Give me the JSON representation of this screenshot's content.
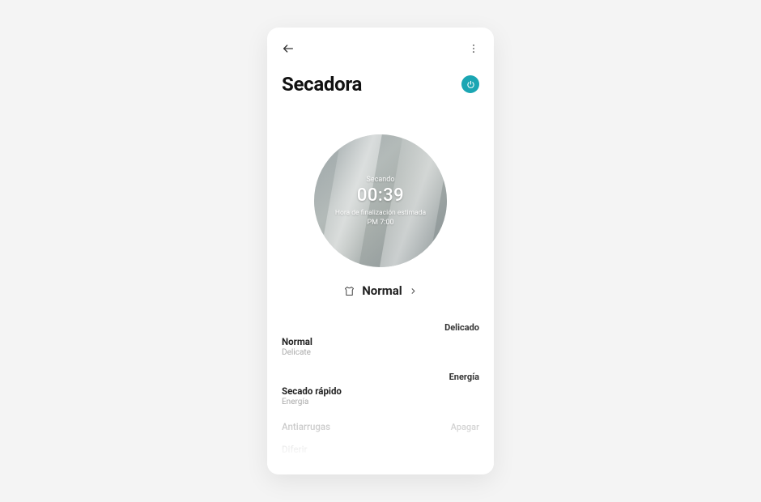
{
  "header": {
    "title": "Secadora"
  },
  "dial": {
    "status": "Secando",
    "time": "00:39",
    "subtitle": "Hora de finalización estimada",
    "eta": "PM 7:00"
  },
  "mode": {
    "label": "Normal"
  },
  "options": {
    "right1": "Delicado",
    "row1": {
      "title": "Normal",
      "sub": "Delicate"
    },
    "right2": "Energía",
    "row2": {
      "title": "Secado rápido",
      "sub": "Energía"
    },
    "row3": {
      "title": "Antiarrugas",
      "right": "Apagar"
    },
    "row4": {
      "title": "Diferir"
    }
  }
}
